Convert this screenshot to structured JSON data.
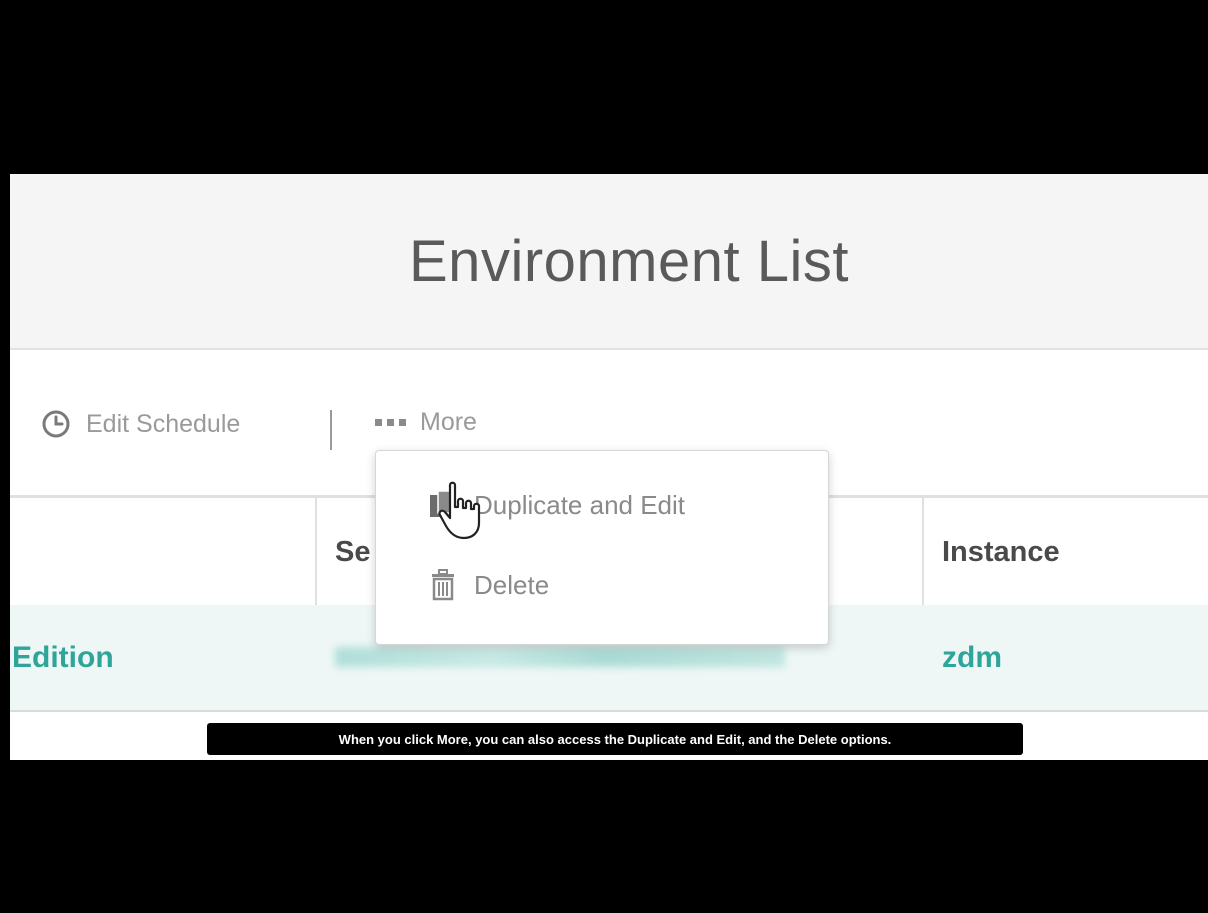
{
  "page": {
    "title": "Environment List"
  },
  "toolbar": {
    "edit_schedule": "Edit Schedule",
    "more": "More"
  },
  "dropdown": {
    "duplicate_edit": "Duplicate and Edit",
    "delete": "Delete"
  },
  "table": {
    "headers": [
      "",
      "Se",
      "Instance"
    ],
    "row": {
      "edition": "Edition",
      "instance": "zdm"
    }
  },
  "caption": "When you click More, you can also access the Duplicate and Edit, and the Delete options.",
  "colors": {
    "accent": "#2fa59a",
    "row_bg": "#eef7f6",
    "muted": "#9a9a9a"
  },
  "icons": [
    "clock-icon",
    "more-dots-icon",
    "duplicate-icon",
    "trash-icon",
    "hand-cursor-icon"
  ]
}
